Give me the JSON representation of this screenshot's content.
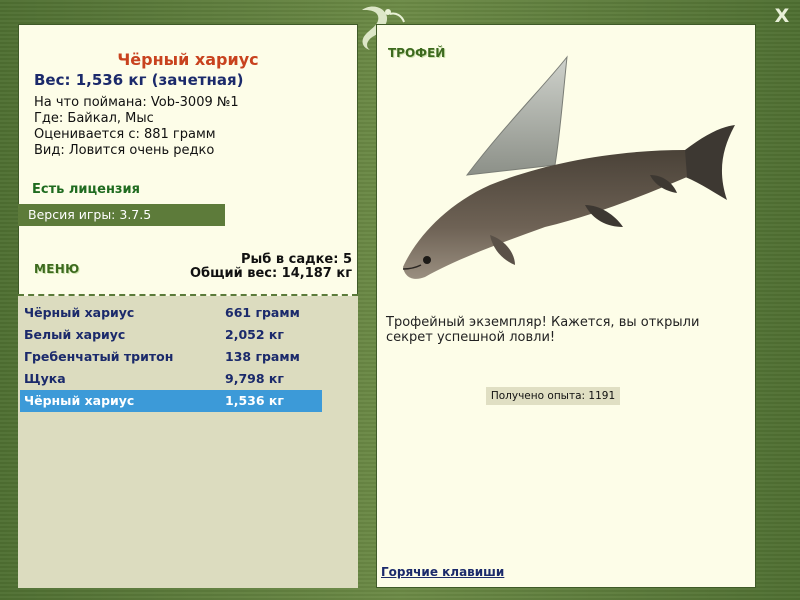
{
  "fish": {
    "title": "Чёрный хариус",
    "weight": "Вес: 1,536 кг (зачетная)",
    "caught_on": "На что поймана: Vob-3009 №1",
    "location": "Где: Байкал, Мыс",
    "valued_from": "Оценивается с: 881 грамм",
    "rarity": "Вид: Ловится очень редко"
  },
  "license": "Есть лицензия",
  "version": "Версия игры: 3.7.5",
  "menu_label": "МЕНЮ",
  "stats": {
    "fish_count": "Рыб в садке: 5",
    "total_weight": "Общий вес: 14,187 кг"
  },
  "catch_list": [
    {
      "name": "Чёрный хариус",
      "weight": "661 грамм"
    },
    {
      "name": "Белый хариус",
      "weight": "2,052 кг"
    },
    {
      "name": "Гребенчатый тритон",
      "weight": "138 грамм"
    },
    {
      "name": "Щука",
      "weight": "9,798 кг"
    },
    {
      "name": "Чёрный хариус",
      "weight": "1,536 кг"
    }
  ],
  "selected_index": 4,
  "trophy_label": "ТРОФЕЙ",
  "trophy_text": "Трофейный экземпляр! Кажется, вы открыли секрет успешной ловли!",
  "experience": "Получено опыта: 1191",
  "hotkeys_link": "Горячие клавиши",
  "close_label": "X",
  "icons": {
    "logo": "lizard-logo-icon",
    "fish": "fish-image",
    "close": "close-icon"
  },
  "colors": {
    "frame": "#5b7b3a",
    "panel": "#fdfde8",
    "selection": "#3c9ad8",
    "title": "#c8421e",
    "weight": "#1b2a6b"
  }
}
